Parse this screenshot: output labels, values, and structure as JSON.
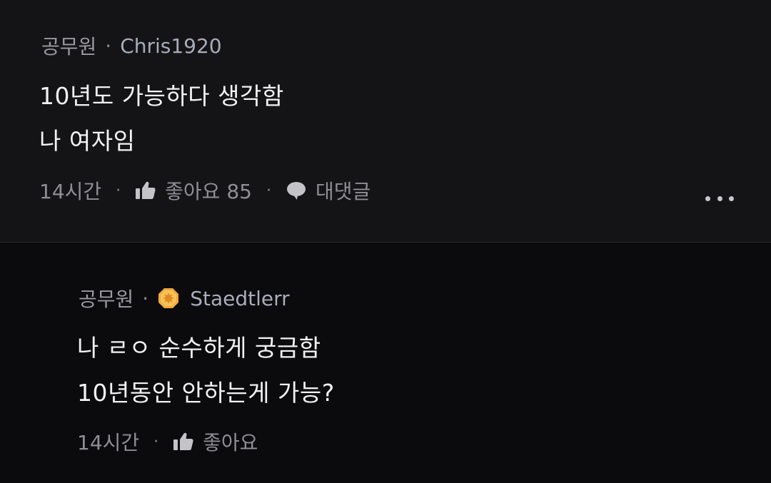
{
  "comments": [
    {
      "job": "공무원",
      "username": "Chris1920",
      "lines": [
        "10년도 가능하다 생각함",
        "나 여자임"
      ],
      "time": "14시간",
      "like_label": "좋아요 85",
      "reply_label": "대댓글"
    },
    {
      "job": "공무원",
      "username": "Staedtlerr",
      "badge_icon": "orange-octagon-badge-icon",
      "lines": [
        "나 ㄹㅇ 순수하게 궁금함",
        "10년동안 안하는게 가능?"
      ],
      "time": "14시간",
      "like_label": "좋아요"
    }
  ],
  "separator": "·"
}
